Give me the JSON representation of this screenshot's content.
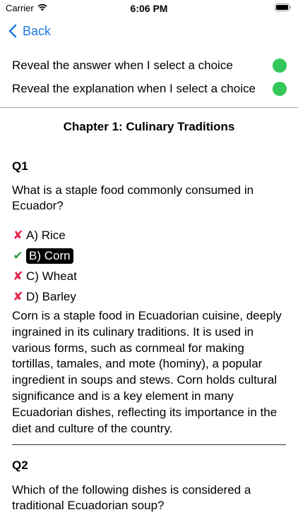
{
  "status_bar": {
    "carrier": "Carrier",
    "time": "6:06 PM",
    "wifi_icon": "wifi-icon",
    "battery_icon": "battery-icon"
  },
  "nav": {
    "back_label": "Back",
    "back_icon": "chevron-left-icon",
    "accent_color": "#1f7ae0"
  },
  "settings": [
    {
      "label": "Reveal the answer when I select a choice",
      "enabled": true
    },
    {
      "label": "Reveal the explanation when I select a choice",
      "enabled": true
    }
  ],
  "toggle_color": "#34c759",
  "chapter_title": "Chapter 1: Culinary Traditions",
  "questions": [
    {
      "number": "Q1",
      "text": "What is a staple food commonly consumed in Ecuador?",
      "choices": [
        {
          "label": "A) Rice",
          "correct": false,
          "selected": false
        },
        {
          "label": "B) Corn",
          "correct": true,
          "selected": true
        },
        {
          "label": "C) Wheat",
          "correct": false,
          "selected": false
        },
        {
          "label": "D) Barley",
          "correct": false,
          "selected": false
        }
      ],
      "explanation": "Corn is a staple food in Ecuadorian cuisine, deeply ingrained in its culinary traditions. It is used in various forms, such as cornmeal for making tortillas, tamales, and mote (hominy), a popular ingredient in soups and stews. Corn holds cultural significance and is a key element in many Ecuadorian dishes, reflecting its importance in the diet and culture of the country."
    },
    {
      "number": "Q2",
      "text": "Which of the following dishes is considered a traditional Ecuadorian soup?"
    }
  ],
  "mark_colors": {
    "wrong": "#e0274b",
    "right": "#2e9e45"
  }
}
